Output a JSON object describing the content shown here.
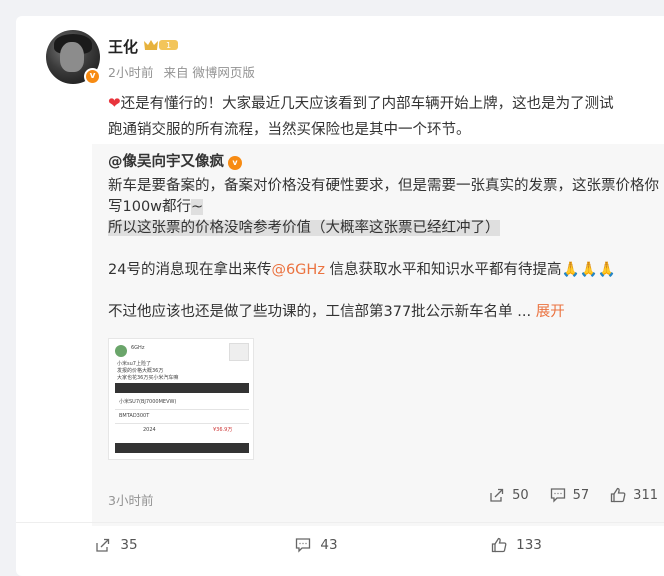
{
  "post": {
    "author": "王化",
    "vip_level": "1",
    "time": "2小时前",
    "source": "来自 微博网页版",
    "text_before": "还是有懂行的！大家最近几天应该看到了内部车辆开始上牌，这也是为了测试",
    "text_after": "跑通销交服的所有流程，当然买保险也是其中一个环节。"
  },
  "repost": {
    "author": "@像吴向宇又像疯",
    "para1a": "新车是要备案的，备案对价格没有硬性要求，但是需要一张真实的发票，这张票价格你",
    "para1b_plain": "写100w都行",
    "para1b_hl": "~",
    "para2": "所以这张票的价格没啥参考价值（大概率这张票已经红冲了）",
    "para3_before": "24号的消息现在拿出来传",
    "para3_mention": "@6GHz",
    "para3_after": " 信息获取水平和知识水平都有待提高",
    "para3_claps": "🙏🙏🙏",
    "para4": "不过他应该也还是做了些功课的，工信部第377批公示新车名单 ... ",
    "expand": "展开",
    "time": "3小时前",
    "reposts": "50",
    "comments": "57",
    "likes": "311",
    "thumb": {
      "name": "6GHz",
      "line1": "小米su7上险了",
      "line2": "发报的价格大概36万",
      "line3": "大家也花36万买小米汽车嘛",
      "line4": "小米SU7(BJ7000MEVW)",
      "line5": "BMTAD300T",
      "line6": "2024",
      "line7": "¥36.9万"
    }
  },
  "footer": {
    "reposts": "35",
    "comments": "43",
    "likes": "133"
  },
  "icons": [
    "heart-icon",
    "verified-icon",
    "vip-badge-icon",
    "repost-icon",
    "comment-icon",
    "like-icon"
  ],
  "colors": {
    "accent": "#eb7340",
    "verified": "#f78b13",
    "meta": "#939393"
  }
}
